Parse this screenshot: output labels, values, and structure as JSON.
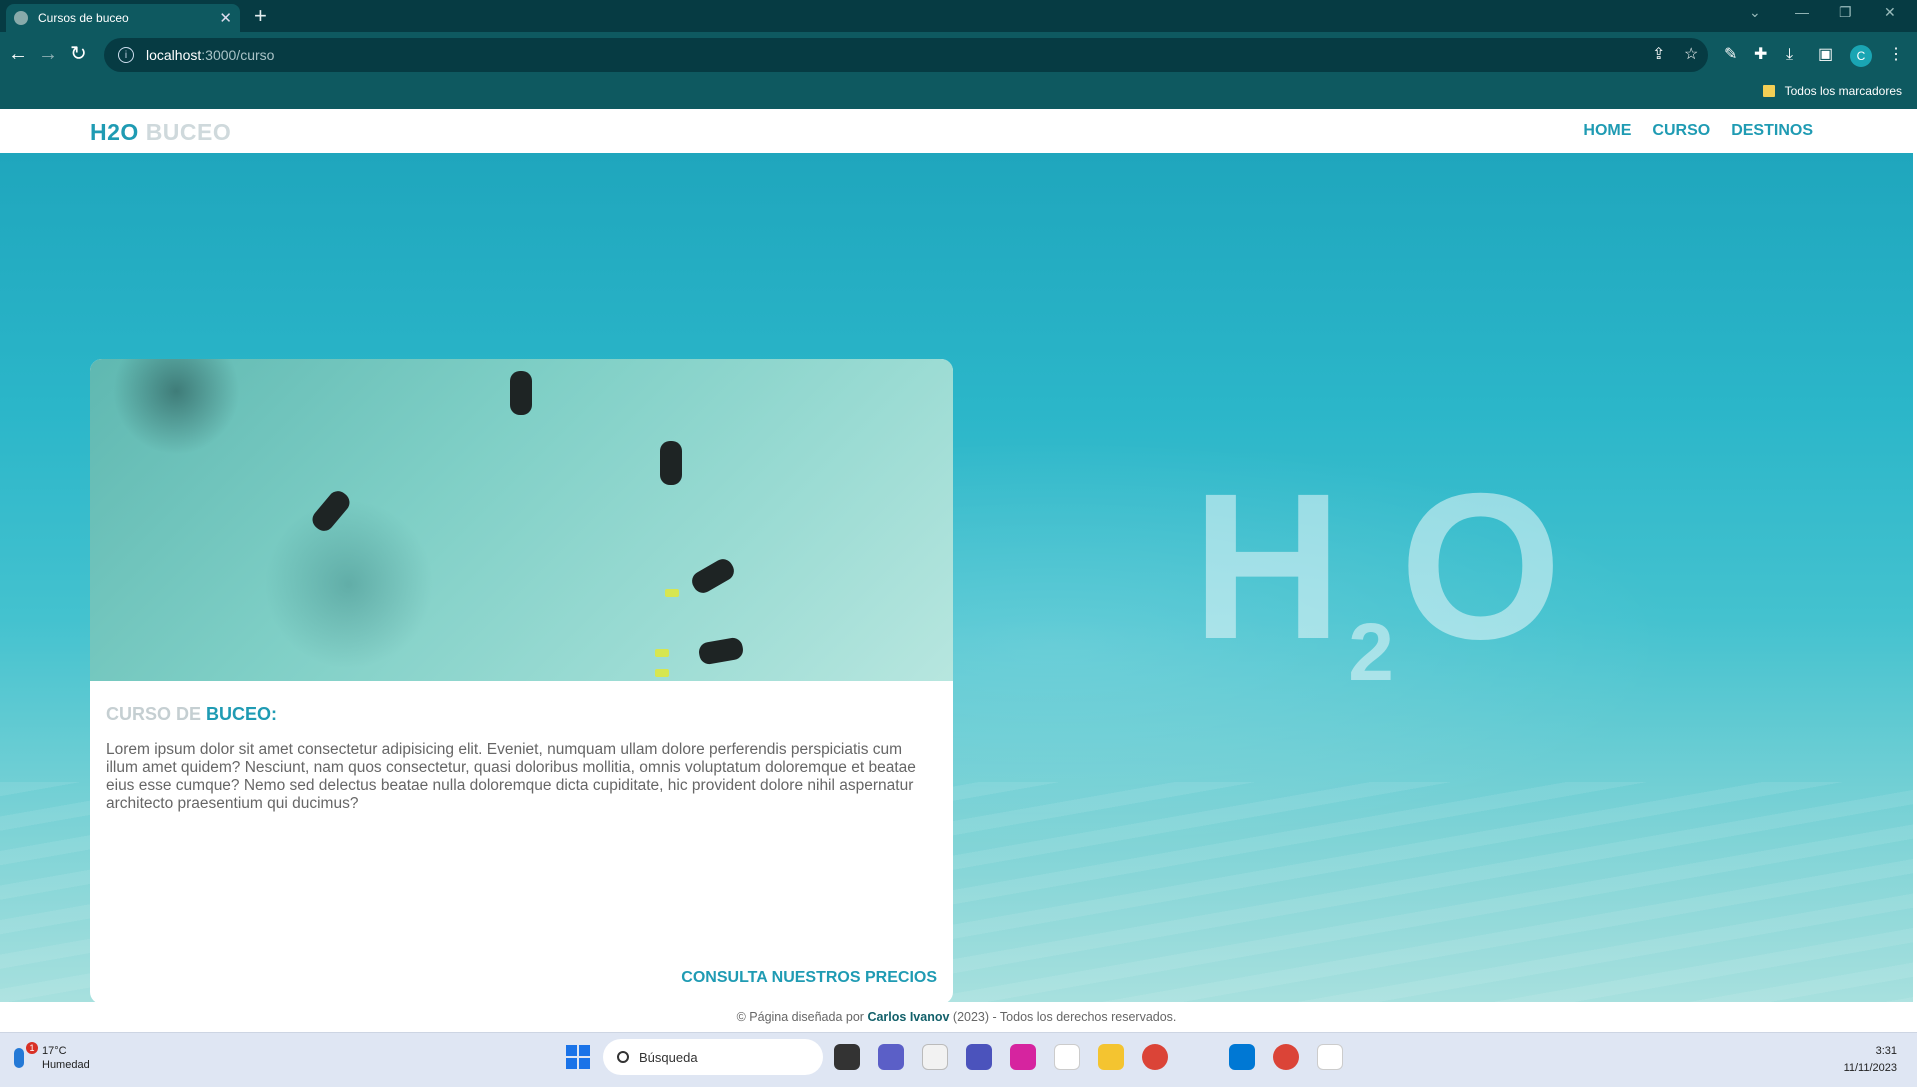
{
  "browser": {
    "tab_title": "Cursos de buceo",
    "url_host": "localhost",
    "url_path": ":3000/curso",
    "bookmarks_label": "Todos los marcadores",
    "profile_initial": "C"
  },
  "site": {
    "logo_part1": "H2O",
    "logo_part2": "BUCEO",
    "nav": [
      "HOME",
      "CURSO",
      "DESTINOS"
    ],
    "hero_text_h": "H",
    "hero_text_sub": "2",
    "hero_text_o": "O",
    "card": {
      "title_part1": "CURSO DE",
      "title_part2": "BUCEO:",
      "body": "Lorem ipsum dolor sit amet consectetur adipisicing elit. Eveniet, numquam ullam dolore perferendis perspiciatis cum illum amet quidem? Nesciunt, nam quos consectetur, quasi doloribus mollitia, omnis voluptatum doloremque et beatae eius esse cumque? Nemo sed delectus beatae nulla doloremque dicta cupiditate, hic provident dolore nihil aspernatur architecto praesentium qui ducimus?",
      "cta": "CONSULTA NUESTROS PRECIOS"
    },
    "footer": {
      "prefix": "© Página diseñada por",
      "author": "Carlos Ivanov",
      "suffix": "(2023) - Todos los derechos reservados."
    }
  },
  "taskbar": {
    "weather_temp": "17°C",
    "weather_desc": "Humedad",
    "weather_badge": "1",
    "search_placeholder": "Búsqueda",
    "time": "3:31",
    "date": "11/11/2023"
  },
  "colors": {
    "accent": "#1f9bb3",
    "chrome_dark": "#063b43",
    "chrome": "#0e5960"
  }
}
